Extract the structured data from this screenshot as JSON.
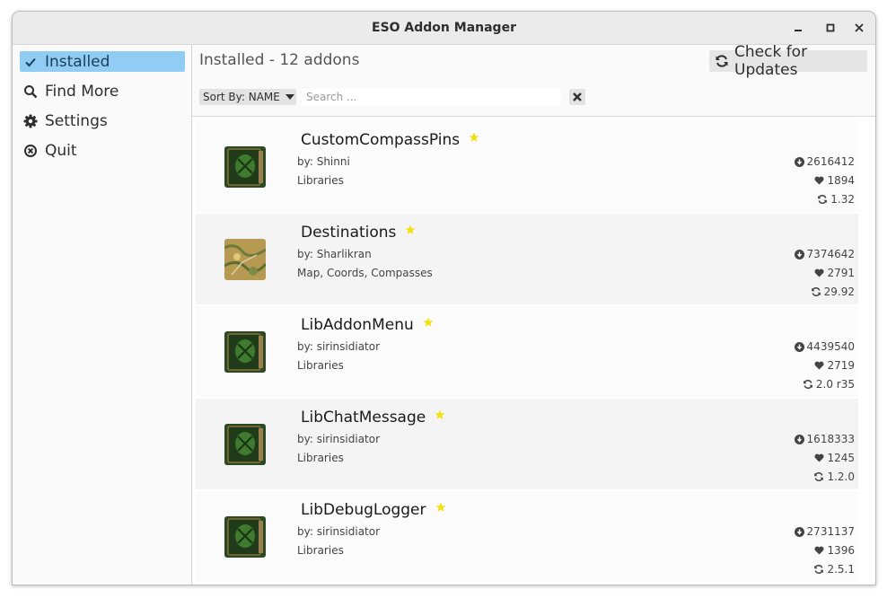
{
  "window": {
    "title": "ESO Addon Manager"
  },
  "sidebar": {
    "items": [
      {
        "label": "Installed",
        "icon": "check-icon",
        "active": true
      },
      {
        "label": "Find More",
        "icon": "search-icon",
        "active": false
      },
      {
        "label": "Settings",
        "icon": "gear-icon",
        "active": false
      },
      {
        "label": "Quit",
        "icon": "close-circle-icon",
        "active": false
      }
    ]
  },
  "main": {
    "heading": "Installed - 12 addons",
    "check_updates_label": "Check for Updates",
    "sort_label": "Sort By: NAME",
    "search_placeholder": "Search ..."
  },
  "addons": [
    {
      "name": "CustomCompassPins",
      "author": "by: Shinni",
      "category": "Libraries",
      "downloads": "2616412",
      "favorites": "1894",
      "version": "1.32",
      "thumb": "book"
    },
    {
      "name": "Destinations",
      "author": "by: Sharlikran",
      "category": "Map, Coords, Compasses",
      "downloads": "7374642",
      "favorites": "2791",
      "version": "29.92",
      "thumb": "map"
    },
    {
      "name": "LibAddonMenu",
      "author": "by: sirinsidiator",
      "category": "Libraries",
      "downloads": "4439540",
      "favorites": "2719",
      "version": "2.0 r35",
      "thumb": "book"
    },
    {
      "name": "LibChatMessage",
      "author": "by: sirinsidiator",
      "category": "Libraries",
      "downloads": "1618333",
      "favorites": "1245",
      "version": "1.2.0",
      "thumb": "book"
    },
    {
      "name": "LibDebugLogger",
      "author": "by: sirinsidiator",
      "category": "Libraries",
      "downloads": "2731137",
      "favorites": "1396",
      "version": "2.5.1",
      "thumb": "book"
    }
  ],
  "colors": {
    "accent": "#90ccf4",
    "star": "#f2e011",
    "titlebar": "#ebebeb"
  }
}
